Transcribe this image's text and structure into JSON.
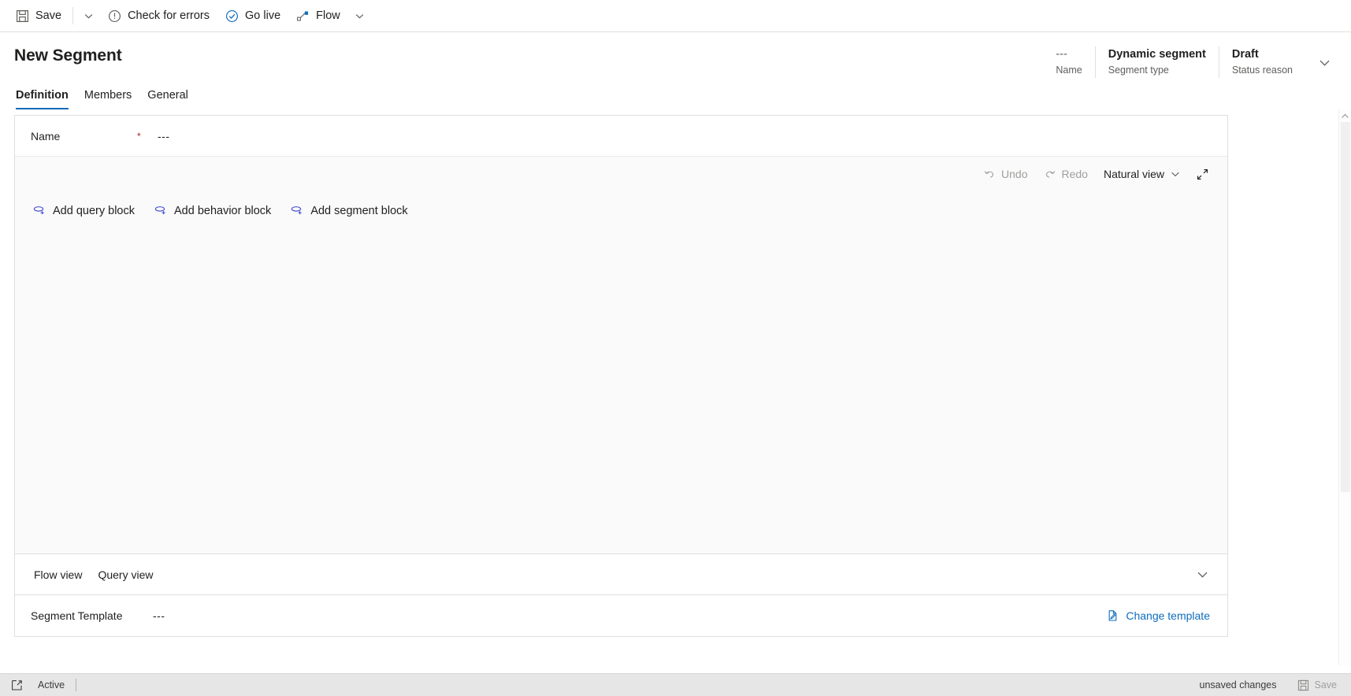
{
  "commandbar": {
    "items": [
      {
        "label": "Save",
        "icon": "save-icon"
      },
      {
        "label": "Check for errors",
        "icon": "error-circle-icon"
      },
      {
        "label": "Go live",
        "icon": "check-circle-icon"
      },
      {
        "label": "Flow",
        "icon": "flow-icon"
      }
    ]
  },
  "header": {
    "title": "New Segment",
    "meta": [
      {
        "value": "---",
        "label": "Name"
      },
      {
        "value": "Dynamic segment",
        "label": "Segment type"
      },
      {
        "value": "Draft",
        "label": "Status reason"
      }
    ]
  },
  "tabs": [
    {
      "label": "Definition",
      "active": true
    },
    {
      "label": "Members",
      "active": false
    },
    {
      "label": "General",
      "active": false
    }
  ],
  "form": {
    "name_label": "Name",
    "name_required": "*",
    "name_value": "---"
  },
  "designer": {
    "undo_label": "Undo",
    "redo_label": "Redo",
    "view_label": "Natural view",
    "blocks": [
      {
        "label": "Add query block"
      },
      {
        "label": "Add behavior block"
      },
      {
        "label": "Add segment block"
      }
    ]
  },
  "viewbar": {
    "tabs": [
      {
        "label": "Flow view"
      },
      {
        "label": "Query view"
      }
    ]
  },
  "template": {
    "label": "Segment Template",
    "value": "---",
    "change_label": "Change template"
  },
  "statusbar": {
    "state": "Active",
    "unsaved": "unsaved changes",
    "save_label": "Save"
  },
  "colors": {
    "accent": "#0f6cbd",
    "link": "#0f6cbd",
    "required": "#a4262c",
    "block_icon": "#4b53d4",
    "disabled": "#a19f9d"
  }
}
